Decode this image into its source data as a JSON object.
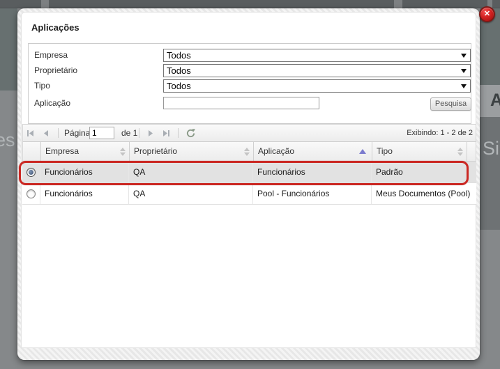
{
  "dialog": {
    "title": "Aplicações"
  },
  "close_button": {
    "glyph": "✕"
  },
  "filters": {
    "fields": [
      {
        "label": "Empresa",
        "value": "Todos"
      },
      {
        "label": "Proprietário",
        "value": "Todos"
      },
      {
        "label": "Tipo",
        "value": "Todos"
      },
      {
        "label": "Aplicação",
        "value": ""
      }
    ],
    "search_button_label": "Pesquisa"
  },
  "pager": {
    "page_label": "Página",
    "page_value": "1",
    "total_label": "de 1",
    "status": "Exibindo: 1 - 2 de 2"
  },
  "table": {
    "columns": [
      {
        "label": "Empresa",
        "sort": "both"
      },
      {
        "label": "Proprietário",
        "sort": "both"
      },
      {
        "label": "Aplicação",
        "sort": "asc"
      },
      {
        "label": "Tipo",
        "sort": "both"
      }
    ],
    "rows": [
      {
        "empresa": "Funcionários",
        "proprietario": "QA",
        "aplicacao": "Funcionários",
        "tipo": "Padrão",
        "selected": true
      },
      {
        "empresa": "Funcionários",
        "proprietario": "QA",
        "aplicacao": "Pool - Funcionários",
        "tipo": "Meus Documentos (Pool)",
        "selected": false
      }
    ]
  },
  "background": {
    "left_fragment": "es",
    "right_fragment": "Si",
    "right_upper_fragment": "A"
  },
  "colors": {
    "annotation_red": "#cb2823",
    "close_button_red": "#b01212",
    "sort_active_arrow": "#7b7bce",
    "selected_row_bg": "#e2e2e2",
    "overlay_gray": "#85888a"
  }
}
